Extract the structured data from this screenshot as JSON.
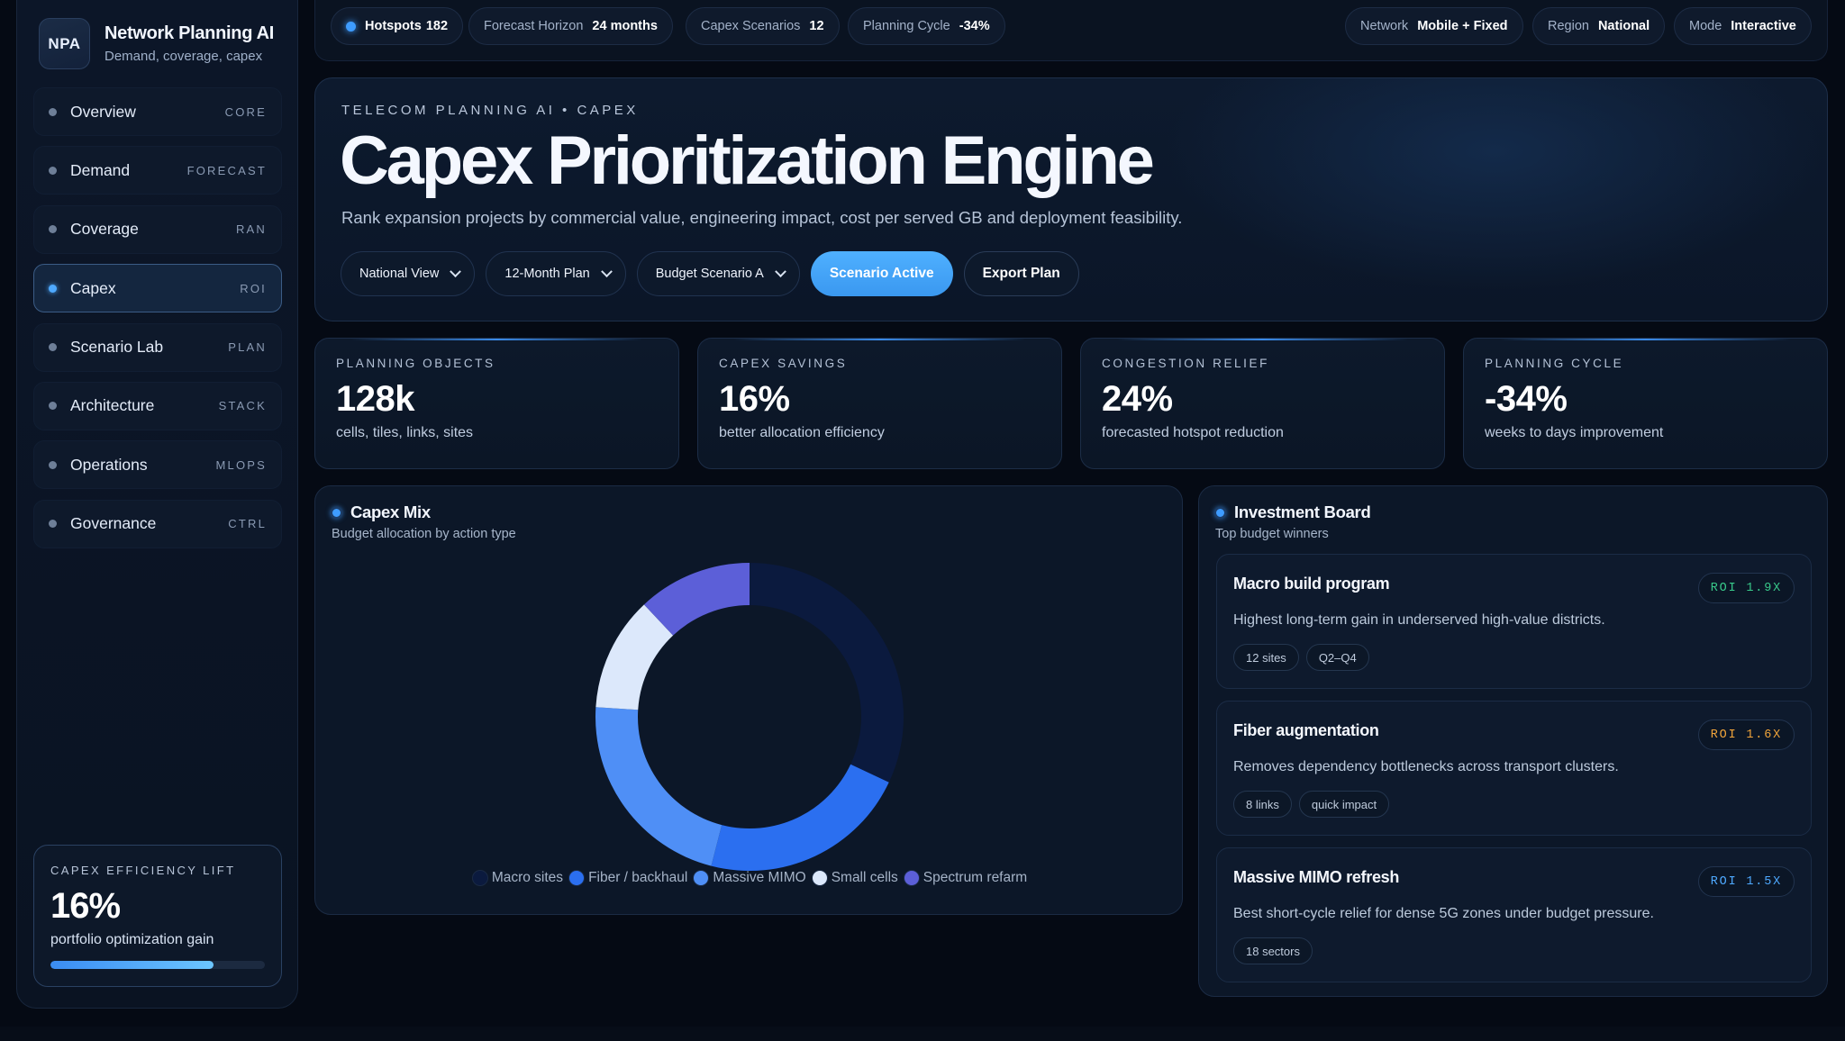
{
  "brand": {
    "logo": "NPA",
    "title": "Network Planning AI",
    "subtitle": "Demand, coverage, capex"
  },
  "nav": [
    {
      "label": "Overview",
      "tag": "CORE",
      "active": false
    },
    {
      "label": "Demand",
      "tag": "FORECAST",
      "active": false
    },
    {
      "label": "Coverage",
      "tag": "RAN",
      "active": false
    },
    {
      "label": "Capex",
      "tag": "ROI",
      "active": true
    },
    {
      "label": "Scenario Lab",
      "tag": "PLAN",
      "active": false
    },
    {
      "label": "Architecture",
      "tag": "STACK",
      "active": false
    },
    {
      "label": "Operations",
      "tag": "MLOPS",
      "active": false
    },
    {
      "label": "Governance",
      "tag": "CTRL",
      "active": false
    }
  ],
  "lift": {
    "title": "CAPEX EFFICIENCY LIFT",
    "value": "16%",
    "subtitle": "portfolio optimization gain",
    "progress": 0.76
  },
  "topbar": {
    "hotspots": {
      "label": "Hotspots",
      "value": "182"
    },
    "horizon": {
      "label": "Forecast Horizon",
      "value": "24 months"
    },
    "scenarios": {
      "label": "Capex Scenarios",
      "value": "12"
    },
    "cycle": {
      "label": "Planning Cycle",
      "value": "-34%"
    },
    "network": {
      "label": "Network",
      "value": "Mobile + Fixed"
    },
    "region": {
      "label": "Region",
      "value": "National"
    },
    "mode": {
      "label": "Mode",
      "value": "Interactive"
    }
  },
  "hero": {
    "eyebrow": "TELECOM PLANNING AI • CAPEX",
    "title": "Capex Prioritization Engine",
    "description": "Rank expansion projects by commercial value, engineering impact, cost per served GB and deployment feasibility.",
    "selects": [
      "National View",
      "12-Month Plan",
      "Budget Scenario A"
    ],
    "primary_button": "Scenario Active",
    "secondary_button": "Export Plan"
  },
  "kpis": [
    {
      "label": "PLANNING OBJECTS",
      "value": "128k",
      "sub": "cells, tiles, links, sites"
    },
    {
      "label": "CAPEX SAVINGS",
      "value": "16%",
      "sub": "better allocation efficiency"
    },
    {
      "label": "CONGESTION RELIEF",
      "value": "24%",
      "sub": "forecasted hotspot reduction"
    },
    {
      "label": "PLANNING CYCLE",
      "value": "-34%",
      "sub": "weeks to days improvement"
    }
  ],
  "mix": {
    "title": "Capex Mix",
    "subtitle": "Budget allocation by action type"
  },
  "chart_data": {
    "type": "pie",
    "donut": true,
    "title": "Capex Mix",
    "categories": [
      "Macro sites",
      "Fiber / backhaul",
      "Massive MIMO",
      "Small cells",
      "Spectrum refarm"
    ],
    "values": [
      32,
      22,
      22,
      12,
      12
    ],
    "colors": [
      "#0b1a3e",
      "#2b6ff0",
      "#4f8ff6",
      "#dce8fb",
      "#5c5fd8"
    ],
    "legend_position": "bottom"
  },
  "board": {
    "title": "Investment Board",
    "subtitle": "Top budget winners",
    "projects": [
      {
        "title": "Macro build program",
        "roi": "ROI 1.9X",
        "roi_color": "#38c98a",
        "description": "Highest long-term gain in underserved high-value districts.",
        "tags": [
          "12 sites",
          "Q2–Q4"
        ]
      },
      {
        "title": "Fiber augmentation",
        "roi": "ROI 1.6X",
        "roi_color": "#f0a43a",
        "description": "Removes dependency bottlenecks across transport clusters.",
        "tags": [
          "8 links",
          "quick impact"
        ]
      },
      {
        "title": "Massive MIMO refresh",
        "roi": "ROI 1.5X",
        "roi_color": "#4ea9ff",
        "description": "Best short-cycle relief for dense 5G zones under budget pressure.",
        "tags": [
          "18 sectors"
        ]
      }
    ]
  }
}
